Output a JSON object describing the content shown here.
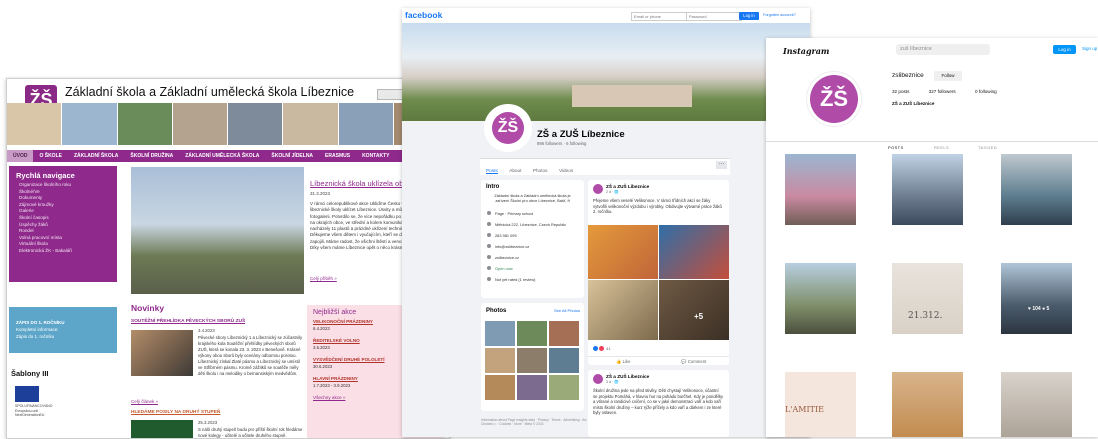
{
  "school": {
    "title": "Základní škola a Základní umělecká škola Líbeznice",
    "search_icon": "⚲",
    "nav": [
      "ÚVOD",
      "O ŠKOLE",
      "ZÁKLADNÍ ŠKOLA",
      "ŠKOLNÍ DRUŽINA",
      "ZÁKLADNÍ UMĚLECKÁ ŠKOLA",
      "ŠKOLNÍ JÍDELNA",
      "ERASMUS",
      "KONTAKTY"
    ],
    "quick_nav": {
      "title": "Rychlá navigace",
      "items": [
        "Organizace školního roku",
        "Školné/Ve",
        "Dokumenty",
        "Zájmové kroužky",
        "Galerie",
        "Školní časopis",
        "Úspěchy žáků",
        "Rondel",
        "Volná pracovní místa",
        "Virtuální škola",
        "Elektronická ŽK - Bakaláři"
      ]
    },
    "story": {
      "title": "Líbeznická škola uklízela obec",
      "date": "31.3.2023",
      "body": "V rámci celorepublikové akce Ukliďme Česko vyrazilo dnes 30 tříd libeznické školy uklízet Líbeznice. Úsvity a můžete prohlédnout ve fotogalerii. Potvrdilo se, že více nepořádku po zimních měsících je na okrajích obce, ve střední a kolem komunikací. Nejvíce se nacházely 11 plastů a prázdné uklízení technickými službami. Děkujeme všem dětem i vyučujícím, kteří se do úklidové akce zapojili. Máme radost, že všichni štěstí a vervou a práce je bavila. Díky všem máme Líbeznice opět o něco krásnější a bez odpadků.",
      "more": "Celý příběh »"
    },
    "zapis": {
      "title": "ZÁPIS DO 1. ROČNÍKU",
      "line1": "Kompletní informace:",
      "link": "Zápis do 1. ročníku"
    },
    "sablony": "Šablony III",
    "eu_text": "SPOLUFINANCOVÁNO Evropskou unií NextGenerationEU",
    "novinky": {
      "title": "Novinky",
      "item1_title": "SOUTĚŽNÍ PŘEHLÍDKA PĚVECKÝCH SBORŮ ZUŠ",
      "item1_date": "3.4.2023",
      "item1_body": "Pěvecké sbory Líbeznický 1 a Líbeznický se zúčastnily krajského kola Soutěžní přehlídky pěveckých sborů ZUŠ, která se konala 23. 3. 2023 v Benešově. Krásné výkony obou sborů byly ocenány odbornou porotou. Líbeznický získal Zlaté pásmo a Líbeznický se umístil ve Stříbrném pásmu. Kromě zážitků se soutěže měly děti školu i na melodiky o bernansiským medvědům.",
      "item1_more": "Celý článek »",
      "item2_title": "HLEDÁME POSILY NA DRUHÝ STUPEŇ",
      "item2_date": "25.3.2023",
      "item2_body": "S náší druhý stupeň budu pro příští školní rok hledáme nové kolegy - učitelé a učitele druhého stupně."
    },
    "akce": {
      "title": "Nejbližší akce",
      "items": [
        {
          "name": "VELIKONOČNÍ PRÁZDNINY",
          "date": "6.4.2023"
        },
        {
          "name": "ŘEDITELSKÉ VOLNO",
          "date": "3.5.2023"
        },
        {
          "name": "VYSVĚDČENÍ DRUHÉ POLOLETÍ",
          "date": "30.6.2023"
        },
        {
          "name": "HLAVNÍ PRÁZDNINY",
          "date": "1.7.2023 - 3.9.2023"
        }
      ],
      "all": "Všechny akce »"
    }
  },
  "facebook": {
    "brand": "facebook",
    "email_placeholder": "Email or phone",
    "password_placeholder": "Password",
    "login": "Log in",
    "forgot": "Forgotten account?",
    "page_name": "ZŠ a ZUŠ Líbeznice",
    "page_stats": "896 followers · 6 following",
    "tabs": [
      "Posts",
      "About",
      "Photos",
      "Videos"
    ],
    "more": "···",
    "intro": {
      "title": "Intro",
      "desc": "Základní škola a Základní umělecká škola je zařízení Školní pro obce Líbeznice, Bašť, ft",
      "rows": [
        "Page · Primary school",
        "Mělnická 222, Líbeznice, Czech Republic",
        "283 981 095",
        "info@zslibeznice.cz",
        "zslibeznice.cz",
        "Open now",
        "Not yet rated (1 review)"
      ]
    },
    "photos": {
      "title": "Photos",
      "see_all": "See All Photos"
    },
    "footer": "Information about Page Insights data · Privacy · Terms · Advertising · Ad Choices ▷ · Cookies · More · Meta © 2023",
    "post1": {
      "name": "ZŠ a ZUŠ Líbeznice",
      "date": "2 d · 🌐",
      "text": "Přejeme všem veselé Velikonoce. V rámci třídních akcí se žáky vytvořili velikonoční výzdobu i výrobky. Obdivujte výtvarné práce žáků 2. ročníku.",
      "plus": "+5",
      "reactions": "41",
      "like": "Like",
      "comment": "Comment"
    },
    "post2": {
      "name": "ZŠ a ZUŠ Líbeznice",
      "date": "3 d · 🌐",
      "text": "Školní družina jede na před stiviky. Děti chystají Velikonoce, účastní se projektu Pomáhá, v hlavnu hur na pohádu burčhel. Kdy je pondělky a vtírané a randicivé cvičení, co se v jaké demonstraci vaří a kdo vaří místo školní družiny – kurz rýže příčely a kdo vaří a dárkem i ze které byly oslaven."
    }
  },
  "instagram": {
    "brand": "Instagram",
    "search_placeholder": "zuš líbeznice",
    "login": "Log in",
    "signup": "Sign up",
    "username": "zslibeznice",
    "follow": "Follow",
    "posts": "32 posts",
    "followers": "327 followers",
    "following": "0 following",
    "full_name": "ZŠ a ZUŠ Líbeznice",
    "tabs": [
      "POSTS",
      "REELS",
      "TAGGED"
    ],
    "likes": "♥ 104   ● 5",
    "card1": "L'AMITIE",
    "card2": "21.312."
  },
  "colors": {
    "school_purple": "#8f2a8c",
    "fb_blue": "#1877f2",
    "ig_blue": "#0095f6"
  }
}
